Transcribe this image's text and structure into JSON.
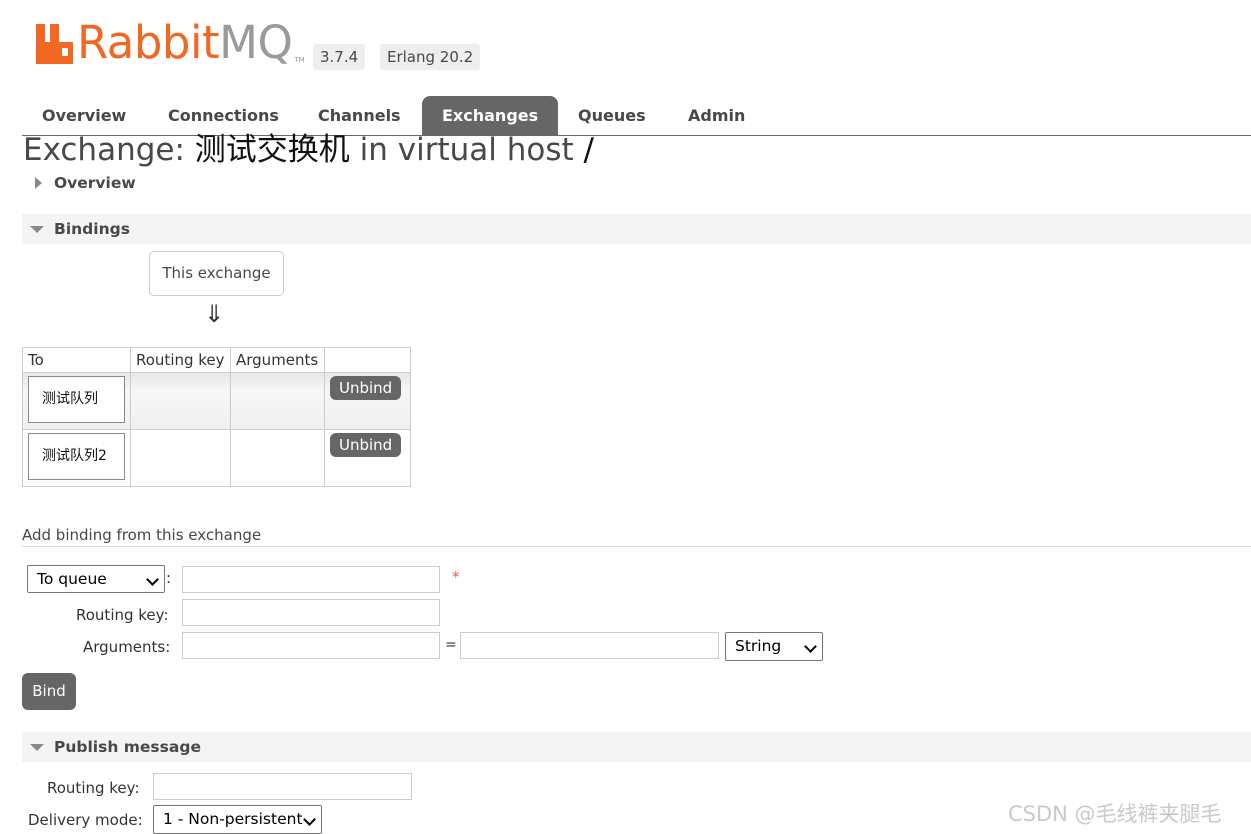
{
  "header": {
    "logo_text_rabbit": "Rabbit",
    "logo_text_mq": "MQ",
    "logo_tm": "TM",
    "version": "3.7.4",
    "erlang": "Erlang 20.2",
    "brand_color": "#f26822"
  },
  "tabs": [
    {
      "label": "Overview",
      "active": false
    },
    {
      "label": "Connections",
      "active": false
    },
    {
      "label": "Channels",
      "active": false
    },
    {
      "label": "Exchanges",
      "active": true
    },
    {
      "label": "Queues",
      "active": false
    },
    {
      "label": "Admin",
      "active": false
    }
  ],
  "page_title": {
    "prefix": "Exchange: ",
    "exchange_name": "测试交换机",
    "middle": " in virtual host ",
    "vhost": "/"
  },
  "sections": {
    "overview": "Overview",
    "bindings": "Bindings",
    "publish": "Publish message"
  },
  "bindings": {
    "source_label": "This exchange",
    "arrow": "⇓",
    "columns": [
      "To",
      "Routing key",
      "Arguments",
      ""
    ],
    "rows": [
      {
        "to": "测试队列",
        "routing_key": "",
        "arguments": "",
        "action": "Unbind"
      },
      {
        "to": "测试队列2",
        "routing_key": "",
        "arguments": "",
        "action": "Unbind"
      }
    ]
  },
  "add_binding": {
    "title": "Add binding from this exchange",
    "destination_type": "To queue",
    "colon": ":",
    "required_mark": "*",
    "routing_key_label": "Routing key:",
    "arguments_label": "Arguments:",
    "equals": "=",
    "arg_type": "String",
    "bind_button": "Bind"
  },
  "publish": {
    "routing_key_label": "Routing key:",
    "delivery_mode_label": "Delivery mode:",
    "delivery_mode": "1 - Non-persistent"
  },
  "watermark": "CSDN @毛线裤夹腿毛"
}
